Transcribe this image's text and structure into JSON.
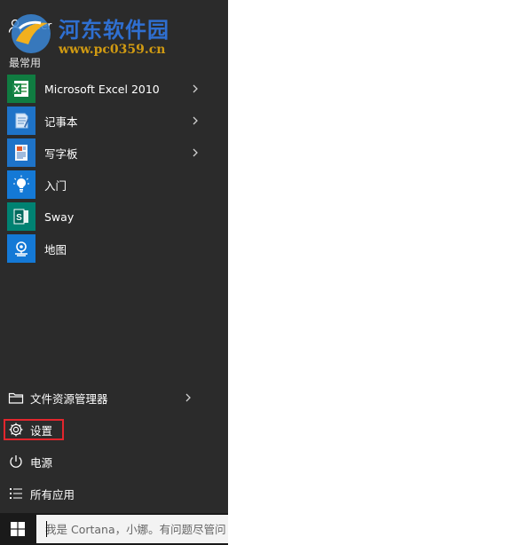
{
  "start_menu": {
    "user_name": "acer",
    "section_label": "最常用",
    "apps": [
      {
        "label": "Microsoft Excel 2010",
        "icon": "excel-icon",
        "tile_color": "#107c41",
        "has_arrow": true
      },
      {
        "label": "记事本",
        "icon": "notepad-icon",
        "tile_color": "#1e73c8",
        "has_arrow": true
      },
      {
        "label": "写字板",
        "icon": "wordpad-icon",
        "tile_color": "#1e73c8",
        "has_arrow": true
      },
      {
        "label": "入门",
        "icon": "lightbulb-icon",
        "tile_color": "#1479d6",
        "has_arrow": false
      },
      {
        "label": "Sway",
        "icon": "sway-icon",
        "tile_color": "#008272",
        "has_arrow": false
      },
      {
        "label": "地图",
        "icon": "maps-icon",
        "tile_color": "#1479d6",
        "has_arrow": false
      }
    ],
    "bottom_items": [
      {
        "label": "文件资源管理器",
        "icon": "folder-icon",
        "has_arrow": true
      },
      {
        "label": "设置",
        "icon": "gear-icon",
        "highlighted": true
      },
      {
        "label": "电源",
        "icon": "power-icon"
      },
      {
        "label": "所有应用",
        "icon": "list-icon"
      }
    ],
    "highlight_color": "#e2262d"
  },
  "taskbar": {
    "search_placeholder": "我是 Cortana，小娜。有问题尽管问我"
  },
  "watermark": {
    "title": "河东软件园",
    "url": "www.pc0359.cn"
  }
}
